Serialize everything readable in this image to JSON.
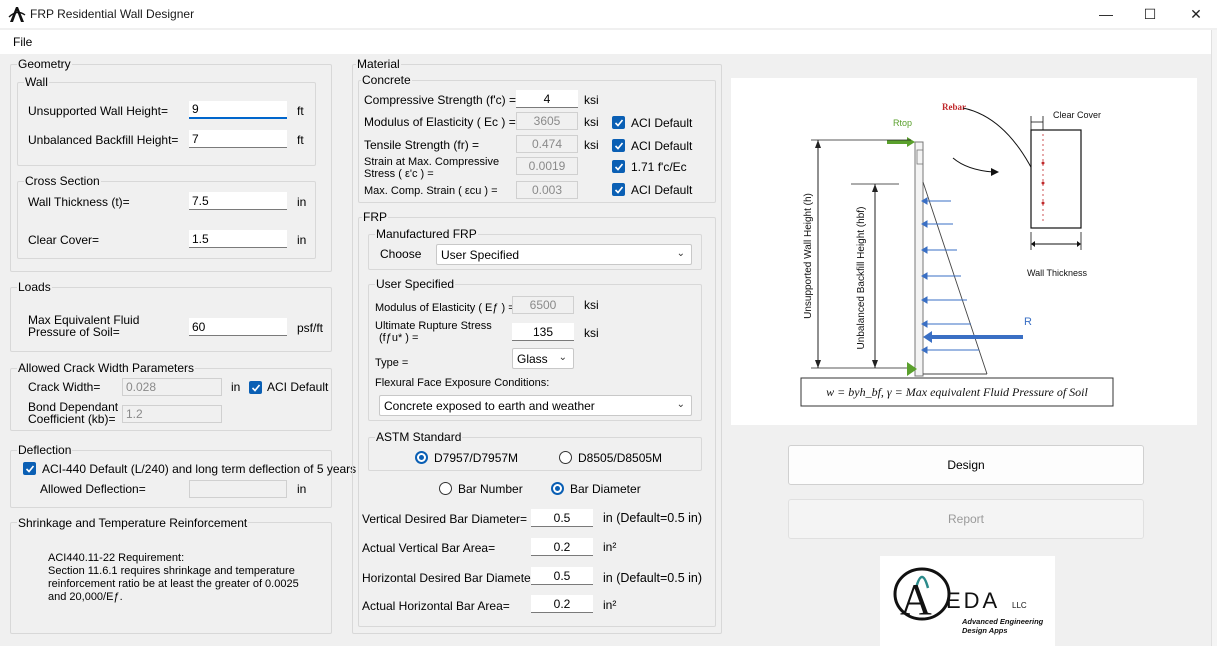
{
  "window": {
    "title": "FRP Residential Wall Designer",
    "minimize": "—",
    "maximize": "☐",
    "close": "✕"
  },
  "menu": {
    "file": "File"
  },
  "geometry": {
    "title": "Geometry",
    "wall": {
      "title": "Wall",
      "unsupported_label": "Unsupported Wall Height=",
      "unsupported_value": "9",
      "unsupported_unit": "ft",
      "backfill_label": "Unbalanced Backfill Height=",
      "backfill_value": "7",
      "backfill_unit": "ft"
    },
    "cross_section": {
      "title": "Cross Section",
      "thickness_label": "Wall Thickness (t)=",
      "thickness_value": "7.5",
      "thickness_unit": "in",
      "cover_label": "Clear Cover=",
      "cover_value": "1.5",
      "cover_unit": "in"
    }
  },
  "loads": {
    "title": "Loads",
    "pressure_label_1": "Max Equivalent Fluid",
    "pressure_label_2": "Pressure of Soil=",
    "pressure_value": "60",
    "pressure_unit": "psf/ft"
  },
  "crack": {
    "title": "Allowed Crack Width Parameters",
    "width_label": "Crack Width=",
    "width_value": "0.028",
    "width_unit": "in",
    "aci_default": "ACI Default",
    "bond_label_1": "Bond Dependant",
    "bond_label_2": "Coefficient (kb)=",
    "bond_value": "1.2"
  },
  "deflection": {
    "title": "Deflection",
    "checkbox_label": "ACI-440 Default (L/240) and long term deflection of 5 years",
    "allowed_label": "Allowed Deflection=",
    "allowed_value": "",
    "allowed_unit": "in"
  },
  "shrinkage": {
    "title": "Shrinkage and Temperature Reinforcement",
    "line1": "ACI440.11-22 Requirement:",
    "line2": "Section 11.6.1 requires shrinkage and temperature",
    "line3": "reinforcement ratio be at least the greater of 0.0025",
    "line4": "and 20,000/Eƒ."
  },
  "material": {
    "title": "Material",
    "concrete": {
      "title": "Concrete",
      "fc_label": "Compressive Strength (f'c) =",
      "fc_value": "4",
      "fc_unit": "ksi",
      "ec_label": "Modulus of Elasticity ( Ec ) =",
      "ec_value": "3605",
      "ec_unit": "ksi",
      "ec_default": "ACI Default",
      "fr_label": "Tensile Strength (fr) =",
      "fr_value": "0.474",
      "fr_unit": "ksi",
      "fr_default": "ACI Default",
      "strain_label_1": "Strain at Max. Compressive",
      "strain_label_2": "Stress ( ε'c ) =",
      "strain_value": "0.0019",
      "strain_default": "1.71 f'c/Ec",
      "ecu_label": "Max. Comp. Strain ( εcu ) =",
      "ecu_value": "0.003",
      "ecu_default": "ACI Default"
    },
    "frp": {
      "title": "FRP",
      "manufactured": {
        "title": "Manufactured FRP",
        "choose_label": "Choose",
        "choose_value": "User Specified"
      },
      "user_specified": {
        "title": "User Specified",
        "ef_label": "Modulus of Elasticity ( Eƒ ) =",
        "ef_value": "6500",
        "ef_unit": "ksi",
        "ffu_label_1": "Ultimate Rupture Stress",
        "ffu_label_2": "(fƒu* ) =",
        "ffu_value": "135",
        "ffu_unit": "ksi",
        "type_label": "Type =",
        "type_value": "Glass",
        "exposure_label": "Flexural Face Exposure Conditions:",
        "exposure_value": "Concrete exposed to earth and weather"
      },
      "astm": {
        "title": "ASTM Standard",
        "opt1": "D7957/D7957M",
        "opt2": "D8505/D8505M"
      },
      "bar_number": "Bar Number",
      "bar_diameter": "Bar Diameter",
      "vert_diam_label": "Vertical Desired Bar Diameter=",
      "vert_diam_value": "0.5",
      "vert_diam_unit": "in  (Default=0.5 in)",
      "vert_area_label": "Actual Vertical Bar Area=",
      "vert_area_value": "0.2",
      "vert_area_unit": "in²",
      "horiz_diam_label": "Horizontal Desired Bar Diameter=",
      "horiz_diam_value": "0.5",
      "horiz_diam_unit": "in  (Default=0.5 in)",
      "horiz_area_label": "Actual Horizontal Bar Area=",
      "horiz_area_value": "0.2",
      "horiz_area_unit": "in²"
    }
  },
  "diagram": {
    "rebar": "Rebar",
    "clear_cover": "Clear Cover",
    "r_top": "Rtop",
    "r": "R",
    "unsupported_h": "Unsupported Wall Height (h)",
    "backfill_h": "Unbalanced Backfill Height (hbf)",
    "wall_thickness": "Wall Thickness",
    "formula": "w = byh_bf, γ = Max equivalent Fluid Pressure of Soil"
  },
  "actions": {
    "design": "Design",
    "report": "Report"
  },
  "logo": {
    "letters_a": "A",
    "letters_rest": "EDA",
    "llc": "LLC",
    "tag1": "Advanced Engineering",
    "tag2": "Design Apps"
  },
  "colors": {
    "accent": "#0a5fb4",
    "arrow_blue": "#3a6fc4",
    "arrow_green": "#5aa02c"
  }
}
